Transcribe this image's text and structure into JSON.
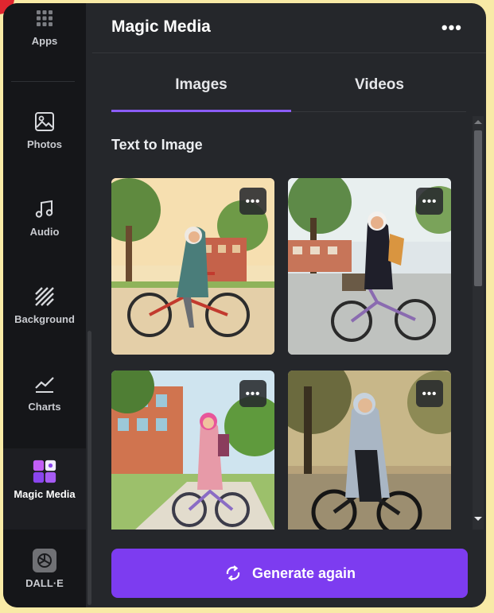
{
  "sidebar": {
    "items": [
      {
        "label": "Apps",
        "icon": "apps-grid-icon"
      },
      {
        "label": "Photos",
        "icon": "image-icon"
      },
      {
        "label": "Audio",
        "icon": "music-note-icon"
      },
      {
        "label": "Background",
        "icon": "stripes-icon"
      },
      {
        "label": "Charts",
        "icon": "line-chart-icon"
      },
      {
        "label": "Magic Media",
        "icon": "magic-media-icon",
        "active": true
      },
      {
        "label": "DALL·E",
        "icon": "openai-logo-icon"
      }
    ]
  },
  "panel": {
    "title": "Magic Media",
    "more": "•••",
    "tabs": [
      {
        "label": "Images",
        "active": true
      },
      {
        "label": "Videos",
        "active": false
      }
    ],
    "section_title": "Text to Image",
    "card_menu": "•••",
    "generate_label": "Generate again"
  },
  "colors": {
    "accent": "#8b5cf6",
    "button": "#7d3cf0",
    "panel_bg": "#25272b",
    "sidebar_bg": "#151619",
    "frame": "#f8eaa6"
  }
}
